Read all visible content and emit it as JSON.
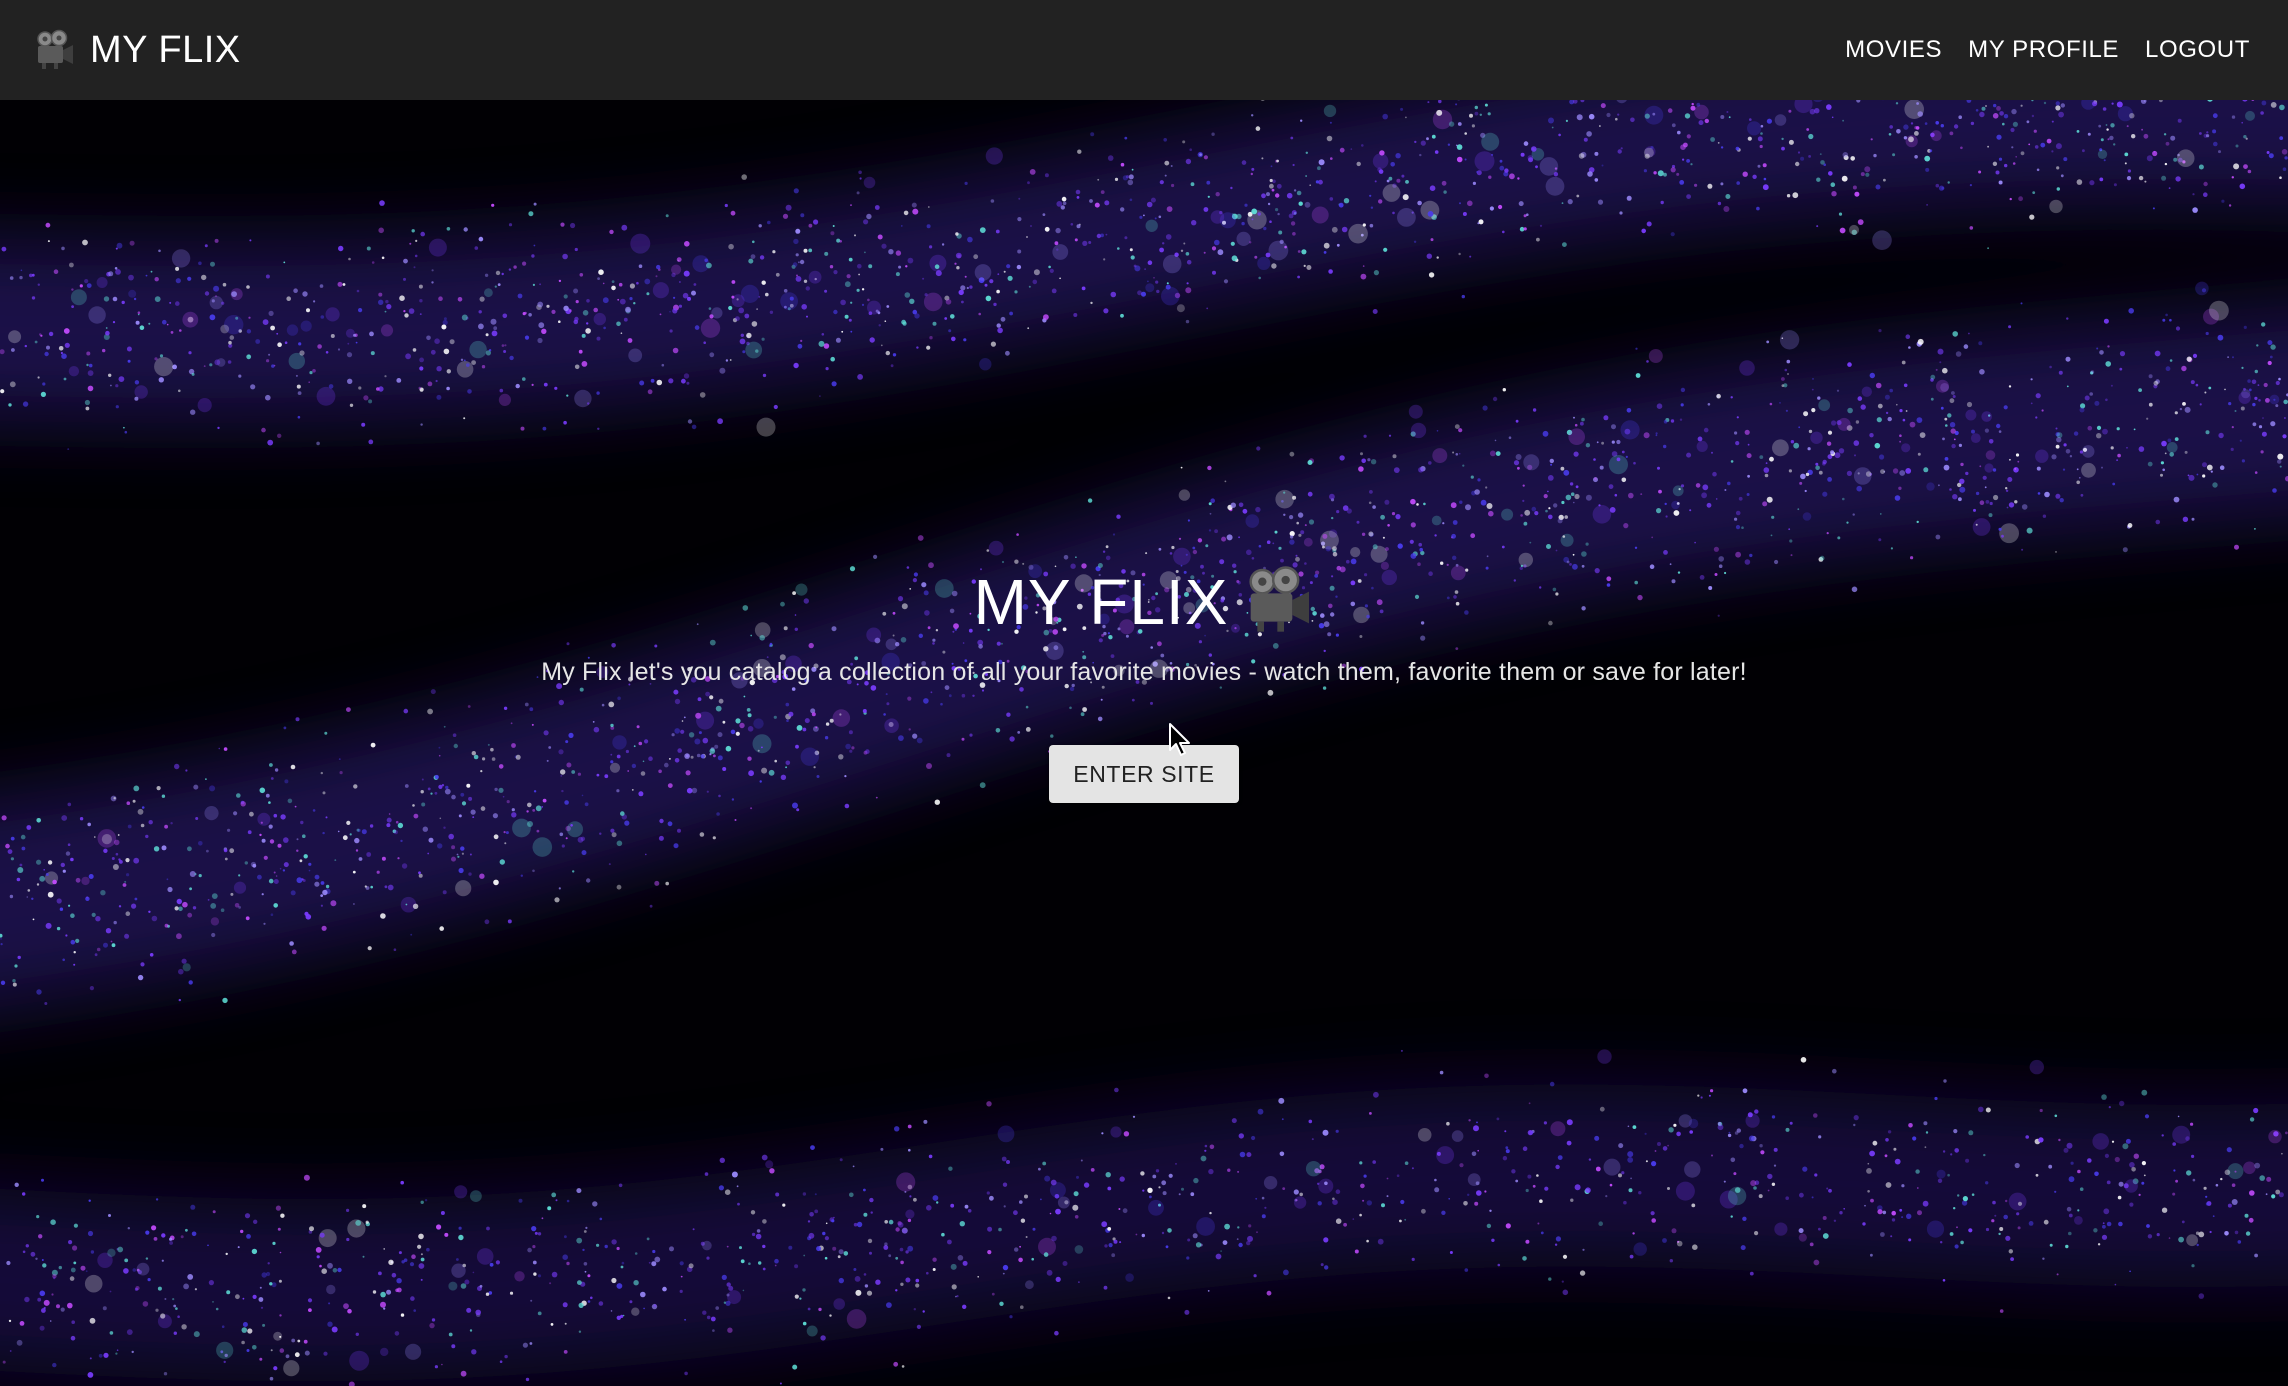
{
  "navbar": {
    "brand": "MY FLIX",
    "brand_icon": "movie-camera-icon",
    "links": [
      "MOVIES",
      "MY PROFILE",
      "LOGOUT"
    ]
  },
  "hero": {
    "title": "MY FLIX",
    "title_icon": "movie-camera-icon",
    "subtitle": "My Flix let's you catalog a collection of all your favorite movies - watch them, favorite them or save for later!",
    "button_label": "ENTER SITE",
    "background": "purple-teal-particle-waves"
  },
  "colors": {
    "navbar_bg": "#222222",
    "page_bg": "#000000",
    "text": "#ffffff",
    "button_bg": "#e4e4e4",
    "particle_purple": "#7a3cff",
    "particle_teal": "#5fe0d8",
    "particle_magenta": "#c44bff"
  }
}
